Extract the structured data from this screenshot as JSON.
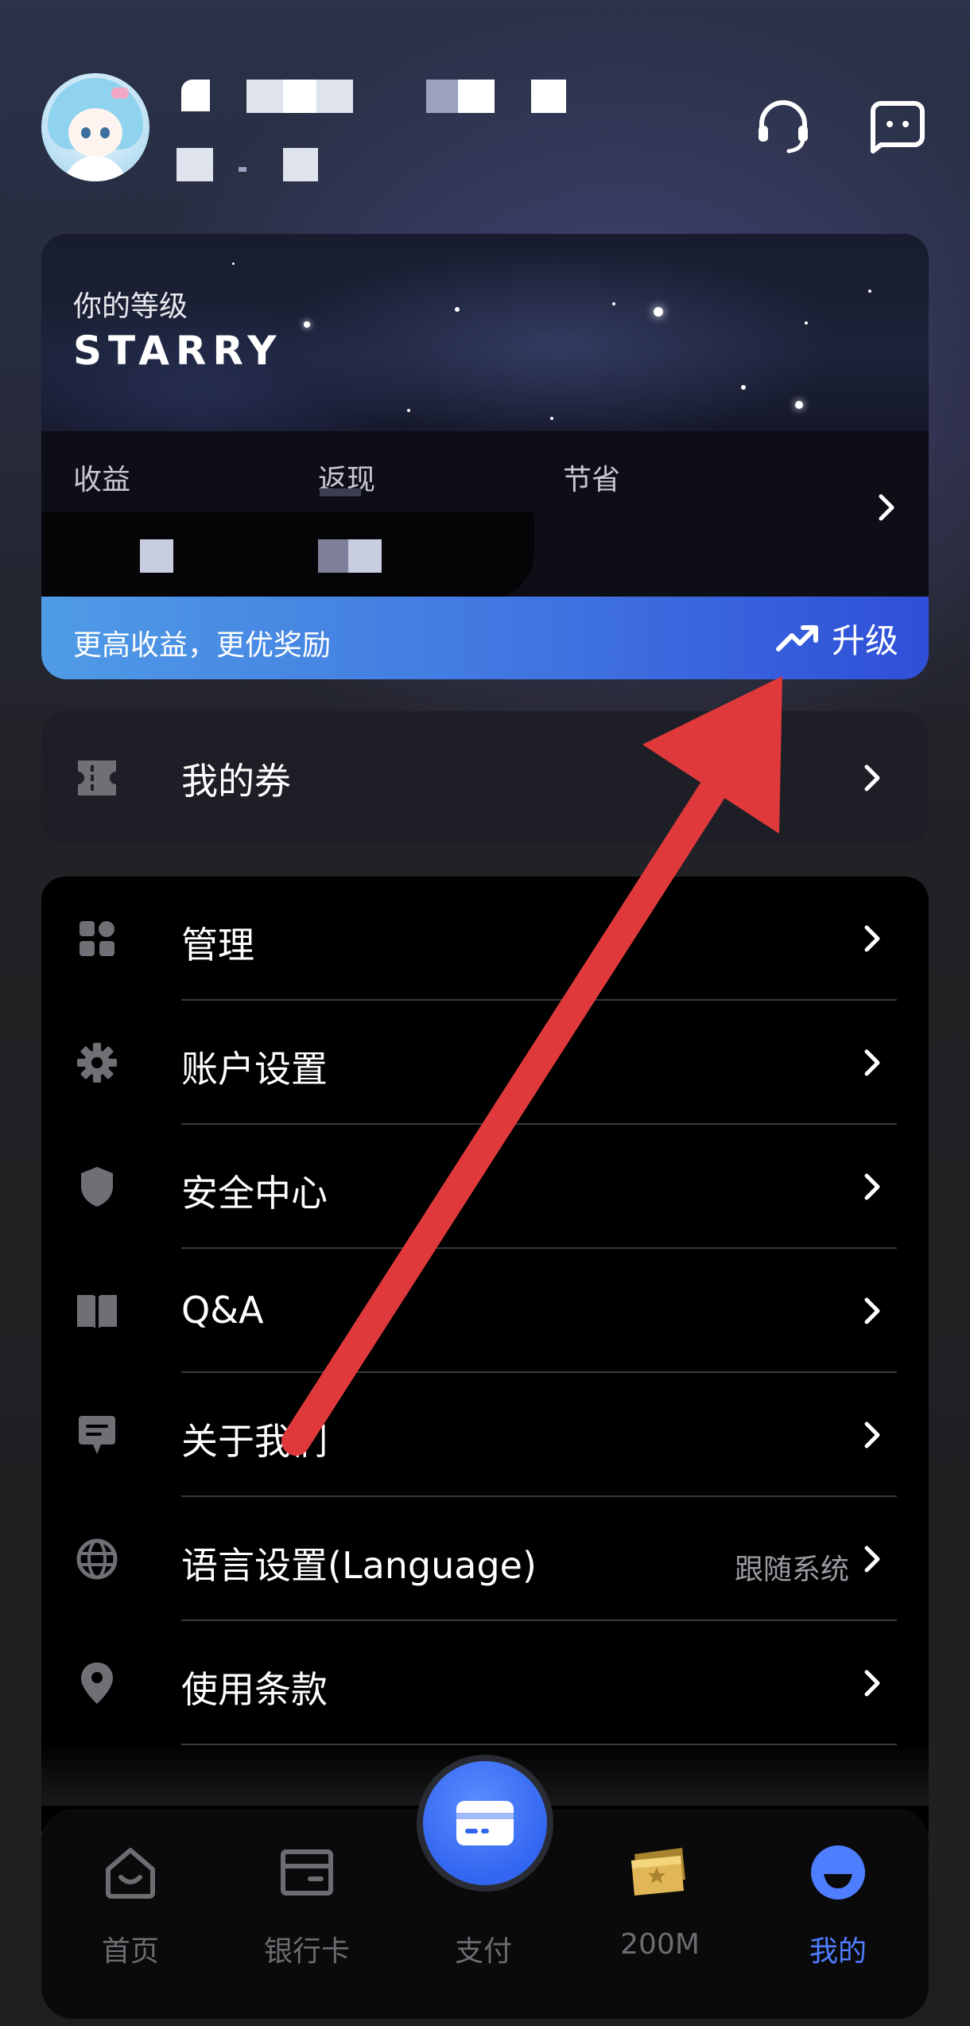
{
  "header": {
    "support_icon": "headset-icon",
    "message_icon": "chat-icon"
  },
  "level_card": {
    "label": "你的等级",
    "level_name": "STARRY",
    "stats": [
      {
        "label": "收益"
      },
      {
        "label": "返现"
      },
      {
        "label": "节省"
      }
    ],
    "upgrade_text": "更高收益，更优奖励",
    "upgrade_button": "升级"
  },
  "coupon": {
    "label": "我的券",
    "icon": "ticket-icon"
  },
  "menu": {
    "items": [
      {
        "label": "管理",
        "icon": "grid-icon"
      },
      {
        "label": "账户设置",
        "icon": "gear-icon"
      },
      {
        "label": "安全中心",
        "icon": "shield-icon"
      },
      {
        "label": "Q&A",
        "icon": "book-icon"
      },
      {
        "label": "关于我们",
        "icon": "message-icon"
      },
      {
        "label": "语言设置(Language)",
        "icon": "globe-icon",
        "value": "跟随系统"
      },
      {
        "label": "使用条款",
        "icon": "location-pin-icon"
      }
    ]
  },
  "bottom_nav": {
    "items": [
      {
        "label": "首页",
        "icon": "home-icon"
      },
      {
        "label": "银行卡",
        "icon": "wallet-icon"
      },
      {
        "label": "支付",
        "icon": "card-icon"
      },
      {
        "label": "200M",
        "icon": "gold-tickets-icon"
      },
      {
        "label": "我的",
        "icon": "profile-icon"
      }
    ],
    "active_color": "#4f7dff",
    "inactive_color": "#6c6c72"
  },
  "colors": {
    "accent_blue": "#3f72e0",
    "arrow_red": "#e0393b"
  }
}
